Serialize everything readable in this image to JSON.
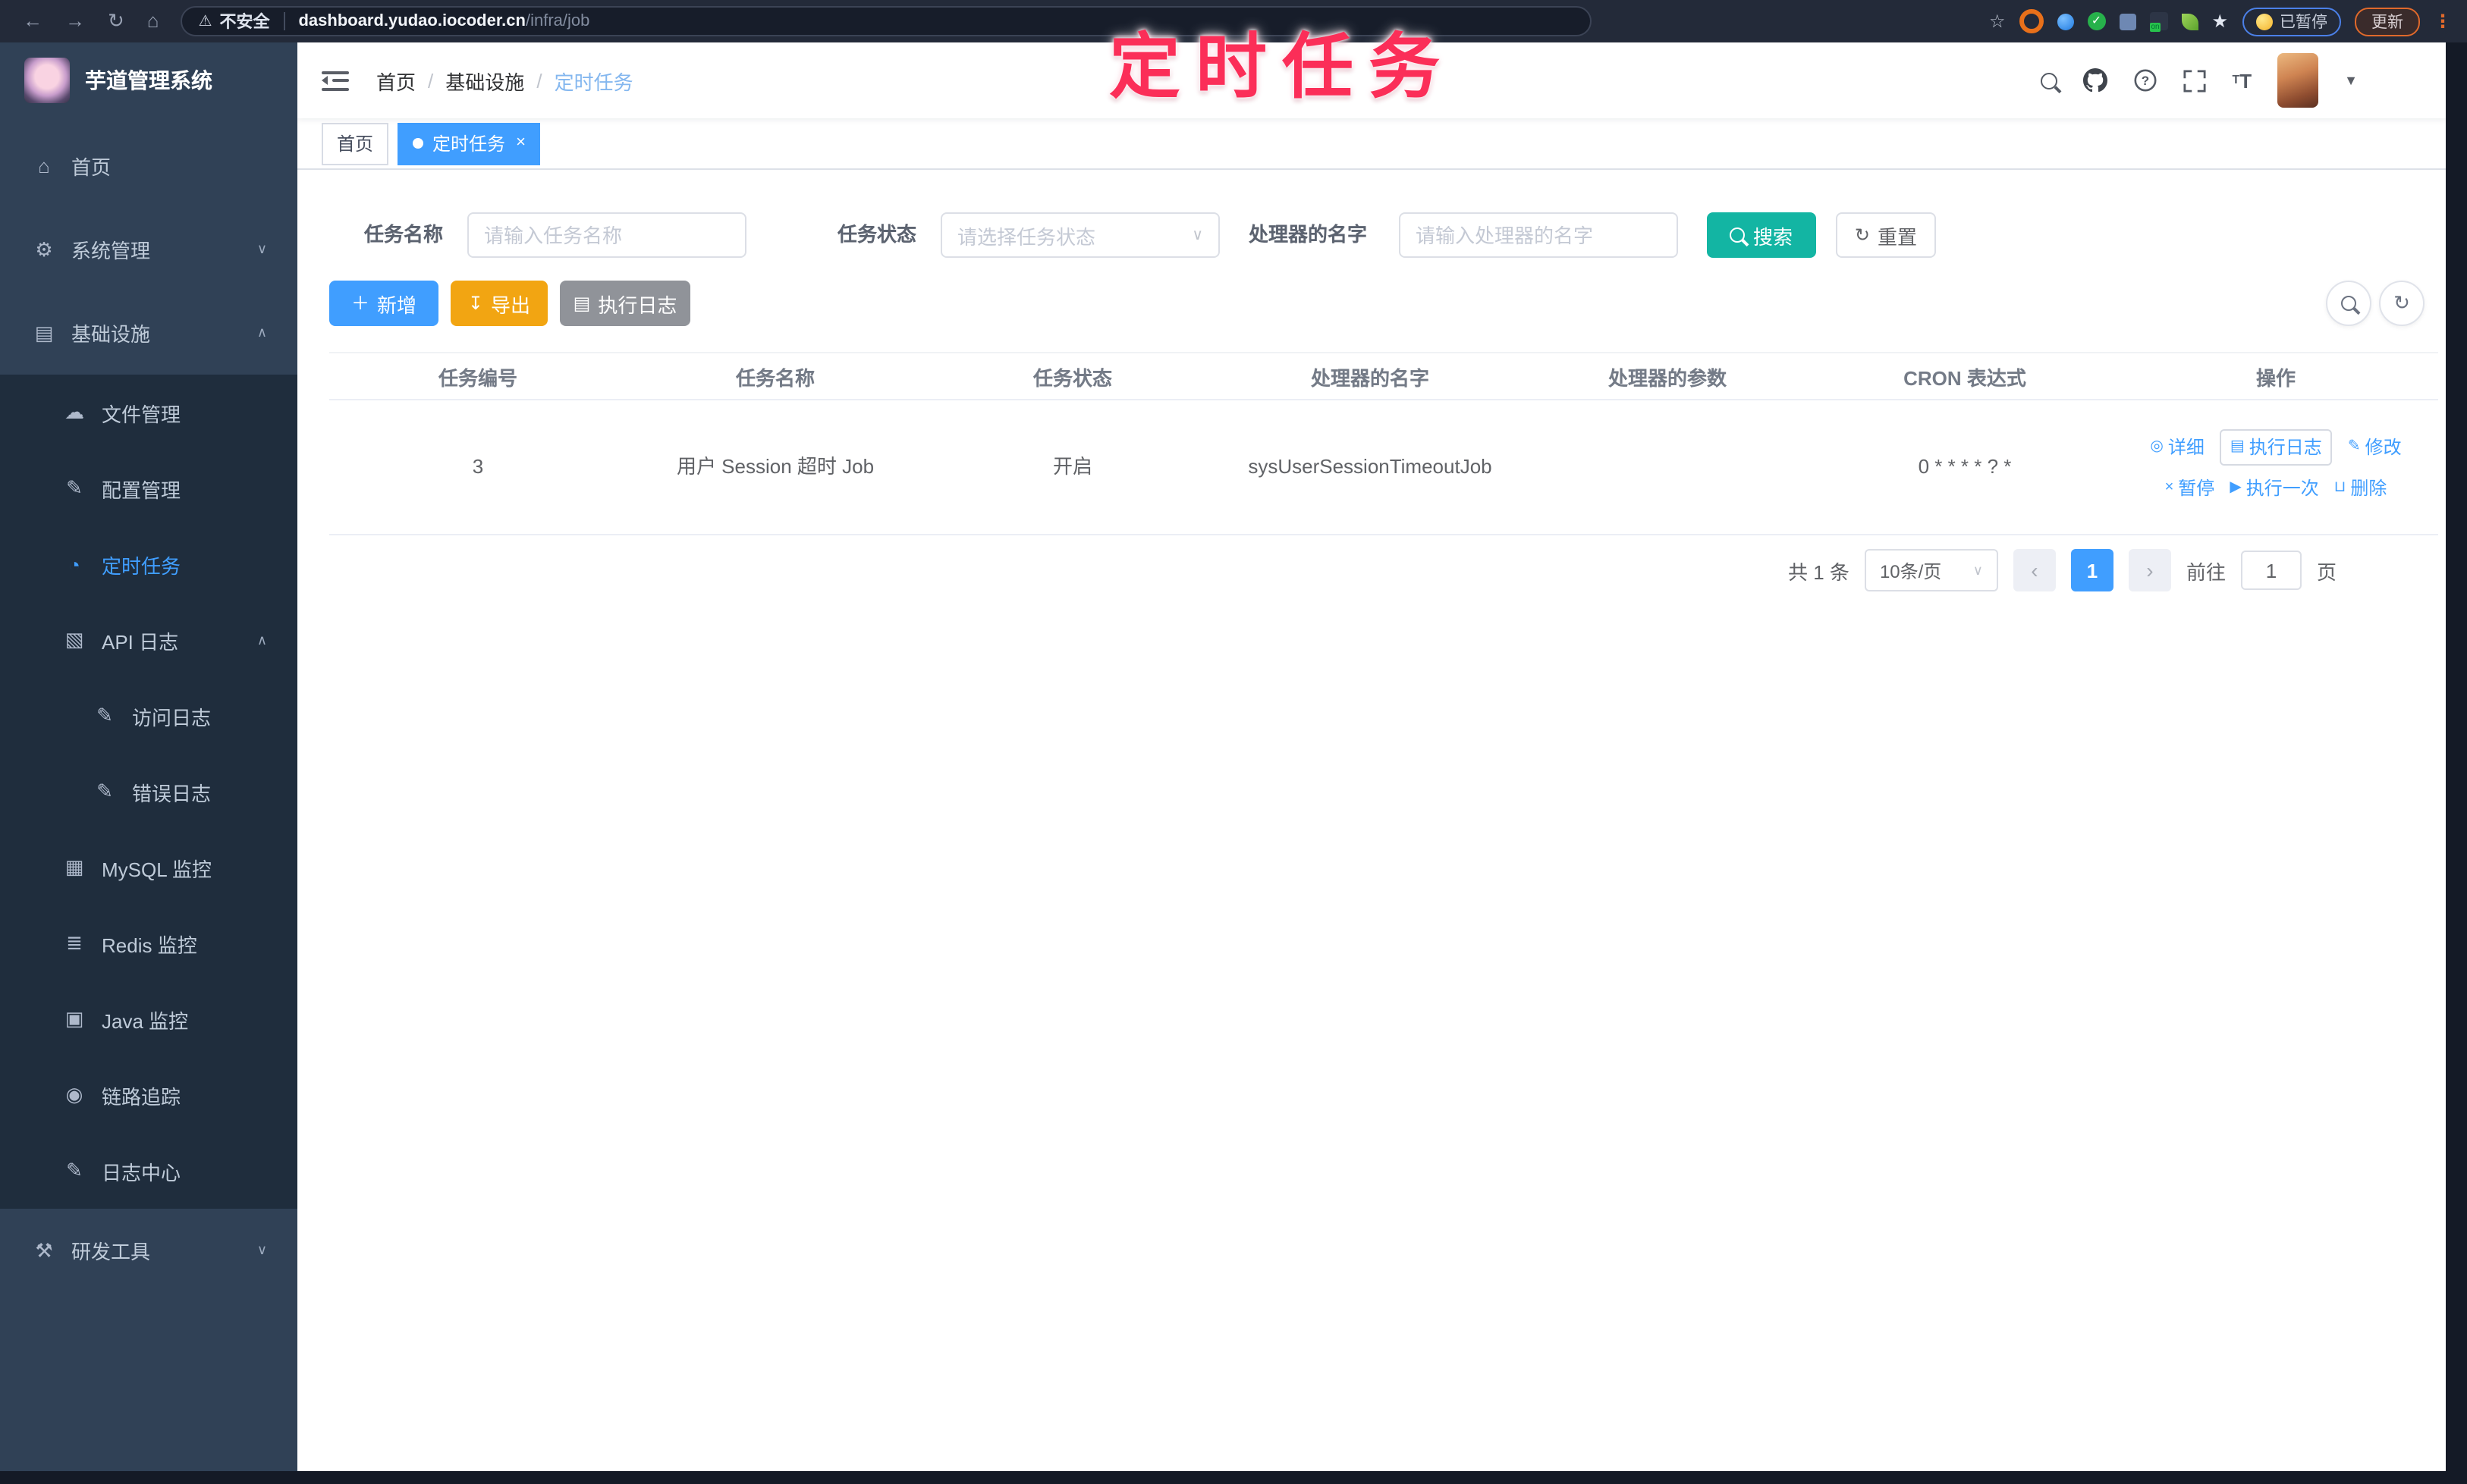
{
  "colors": {
    "accent": "#409eff",
    "search_button": "#13b5a3",
    "warning_button": "#f2a512",
    "info_button": "#909399",
    "sidebar_bg": "#304156",
    "submenu_bg": "#1f2d3d",
    "annotation_pink": "#fb2e58"
  },
  "annotation": {
    "text": "定时任务"
  },
  "browser": {
    "security_label": "不安全",
    "url_host": "dashboard.yudao.iocoder.cn",
    "url_path": "/infra/job",
    "paused_badge": "已暂停",
    "update_button": "更新",
    "nav_icons": [
      "back-arrow",
      "forward-arrow",
      "reload",
      "home"
    ],
    "extension_icons": [
      "bookmark-star",
      "orange-ring",
      "blue-drop",
      "green-check",
      "blue-puzzle",
      "on-badge",
      "green-leaf",
      "white-star"
    ]
  },
  "sidebar": {
    "logo_title": "芋道管理系统",
    "items": [
      {
        "label": "首页",
        "icon": "home-icon"
      },
      {
        "label": "系统管理",
        "icon": "gear-icon",
        "chevron": "∨"
      },
      {
        "label": "基础设施",
        "icon": "infrastructure-icon",
        "chevron": "∧"
      },
      {
        "label": "文件管理",
        "icon": "cloud-upload-icon"
      },
      {
        "label": "配置管理",
        "icon": "edit-icon"
      },
      {
        "label": "定时任务",
        "icon": "timer-icon"
      },
      {
        "label": "API 日志",
        "icon": "api-log-icon",
        "chevron": "∧"
      },
      {
        "label": "访问日志",
        "icon": "edit-icon"
      },
      {
        "label": "错误日志",
        "icon": "edit-icon"
      },
      {
        "label": "MySQL 监控",
        "icon": "database-icon"
      },
      {
        "label": "Redis 监控",
        "icon": "layers-icon"
      },
      {
        "label": "Java 监控",
        "icon": "monitor-icon"
      },
      {
        "label": "链路追踪",
        "icon": "eye-icon"
      },
      {
        "label": "日志中心",
        "icon": "edit-icon"
      },
      {
        "label": "研发工具",
        "icon": "toolbox-icon",
        "chevron": "∨"
      }
    ]
  },
  "header": {
    "breadcrumb": [
      "首页",
      "基础设施",
      "定时任务"
    ],
    "separator": "/",
    "icons": [
      "search-icon",
      "github-icon",
      "help-icon",
      "fullscreen-icon",
      "font-size-icon",
      "avatar",
      "caret-down-icon"
    ]
  },
  "tags": {
    "home": "首页",
    "active": "定时任务"
  },
  "filters": {
    "name_label": "任务名称",
    "name_placeholder": "请输入任务名称",
    "status_label": "任务状态",
    "status_placeholder": "请选择任务状态",
    "handler_label": "处理器的名字",
    "handler_placeholder": "请输入处理器的名字",
    "search_label": "搜索",
    "reset_label": "重置"
  },
  "toolbar": {
    "add_label": "新增",
    "export_label": "导出",
    "exec_log_label": "执行日志"
  },
  "table": {
    "headers": [
      "任务编号",
      "任务名称",
      "任务状态",
      "处理器的名字",
      "处理器的参数",
      "CRON 表达式",
      "操作"
    ],
    "row": {
      "id": "3",
      "name": "用户 Session 超时 Job",
      "status": "开启",
      "handler": "sysUserSessionTimeoutJob",
      "param": "",
      "cron": "0 * * * * ? *"
    },
    "actions": {
      "detail": "详细",
      "exec_log": "执行日志",
      "edit": "修改",
      "pause": "暂停",
      "run_once": "执行一次",
      "delete": "删除"
    }
  },
  "pagination": {
    "total": "共 1 条",
    "page_size": "10条/页",
    "page": "1",
    "goto_label": "前往",
    "goto_value": "1",
    "page_unit": "页"
  }
}
